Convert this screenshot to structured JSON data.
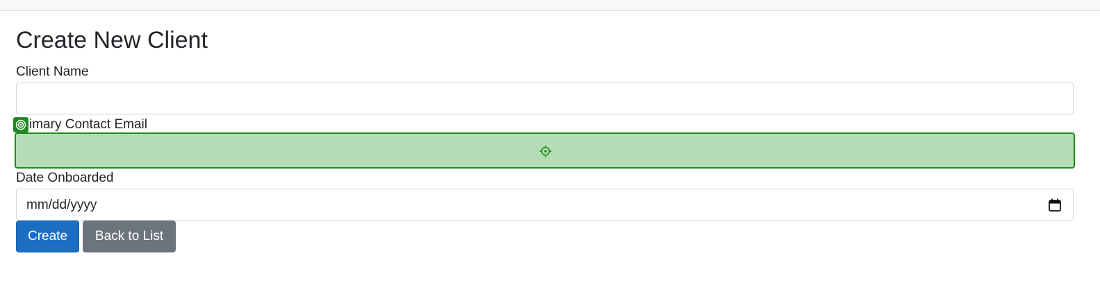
{
  "page": {
    "title": "Create New Client"
  },
  "form": {
    "client_name": {
      "label": "Client Name",
      "value": "",
      "placeholder": ""
    },
    "primary_contact_email": {
      "label": "imary Contact Email",
      "value": "",
      "placeholder": ""
    },
    "date_onboarded": {
      "label": "Date Onboarded",
      "display_value": "mm/dd/yyyy"
    }
  },
  "buttons": {
    "create_label": "Create",
    "back_label": "Back to List"
  },
  "colors": {
    "primary": "#1b6ec2",
    "secondary": "#6c757d",
    "highlight_fill": "#b5ddb5",
    "highlight_border": "#1e8a1e"
  },
  "icons": {
    "highlight_badge": "target-badge-icon",
    "field_target": "crosshair-icon",
    "date_picker": "calendar-icon"
  }
}
